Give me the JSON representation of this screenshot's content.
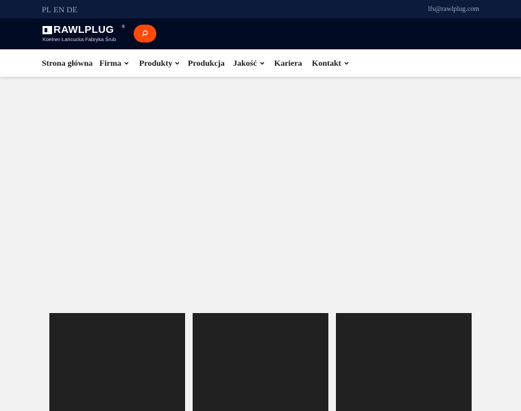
{
  "topbar": {
    "languages": [
      "PL",
      "EN",
      "DE"
    ],
    "email": "lfs@rawlplug.com"
  },
  "header": {
    "logo_text": "RAWLPLUG",
    "logo_tm": "®",
    "logo_subtitle": "Koelner Łańcucka Fabryka Śrub",
    "search_icon": "search-icon",
    "accent_color": "#ff4a0a"
  },
  "nav": {
    "items": [
      {
        "label": "Strona główna",
        "has_dropdown": false
      },
      {
        "label": "Firma",
        "has_dropdown": true
      },
      {
        "label": "Produkty",
        "has_dropdown": true
      },
      {
        "label": "Produkcja",
        "has_dropdown": false
      },
      {
        "label": "Jakość",
        "has_dropdown": true
      },
      {
        "label": "Kariera",
        "has_dropdown": false
      },
      {
        "label": "Kontakt",
        "has_dropdown": true
      }
    ]
  },
  "colors": {
    "topbar_bg": "#0c1a3b",
    "header_bg": "#020b24",
    "page_bg": "#f2f2f2",
    "card_bg": "#212121"
  }
}
